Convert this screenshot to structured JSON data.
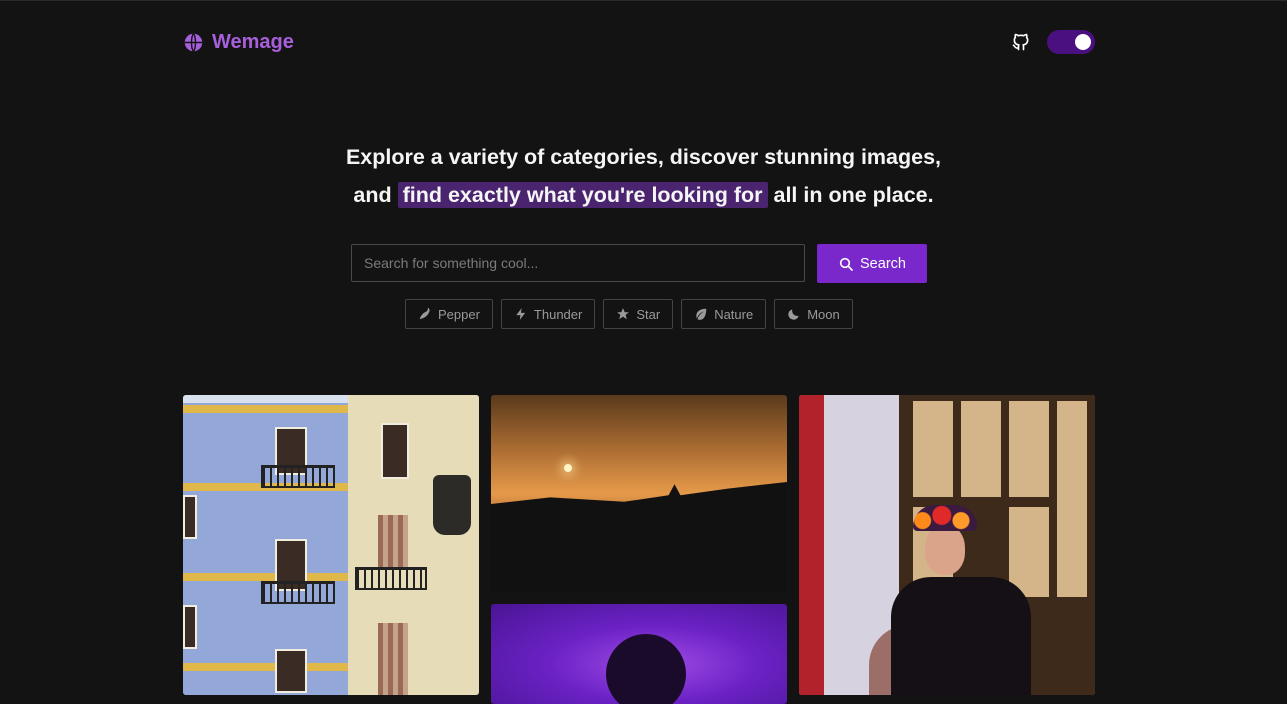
{
  "brand": {
    "name": "Wemage",
    "icon": "globe-icon",
    "accent": "#a85fdc"
  },
  "header": {
    "github_icon": "github-icon",
    "theme_toggle": "on",
    "toggle_color": "#4a1080"
  },
  "hero": {
    "line1": "Explore a variety of categories, discover stunning images,",
    "line2_prefix": "and",
    "line2_highlight": "find exactly what you're looking for",
    "line2_suffix": "all in one place."
  },
  "search": {
    "placeholder": "Search for something cool...",
    "value": "",
    "button_label": "Search",
    "button_icon": "search-icon",
    "button_color": "#7a27cc"
  },
  "chips": [
    {
      "label": "Pepper",
      "icon": "pepper-icon"
    },
    {
      "label": "Thunder",
      "icon": "thunder-icon"
    },
    {
      "label": "Star",
      "icon": "star-icon"
    },
    {
      "label": "Nature",
      "icon": "leaf-icon"
    },
    {
      "label": "Moon",
      "icon": "moon-icon"
    }
  ],
  "gallery": {
    "photos": [
      {
        "subject": "colorful balconied buildings"
      },
      {
        "subject": "sunset over pagoda silhouette"
      },
      {
        "subject": "portrait in purple light"
      },
      {
        "subject": "catrina face paint with flower crown"
      }
    ]
  }
}
